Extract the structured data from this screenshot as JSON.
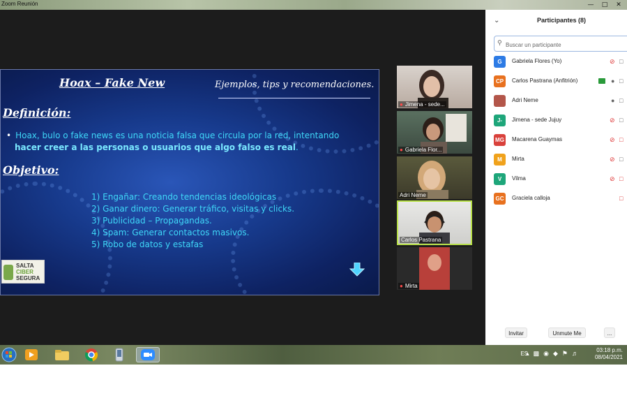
{
  "window": {
    "title": "Zoom Reunión"
  },
  "slide": {
    "title": "Hoax – Fake New",
    "subtitle": "Ejemplos, tips y recomendaciones.",
    "definition_heading": "Definición:",
    "definition_text": "Hoax, bulo o fake news es una noticia falsa que circula por la red, intentando",
    "definition_bold": "hacer creer a las personas o usuarios que algo falso es real",
    "definition_end": ".",
    "objective_heading": "Objetivo:",
    "objectives": [
      "1)  Engañar: Creando tendencias ideológicas",
      "2)  Ganar dinero: Generar tráfico, visitas y clicks.",
      "3)  Publicidad – Propagandas.",
      "4)  Spam: Generar contactos masivos.",
      "5)  Robo de datos y estafas"
    ],
    "logo": {
      "line1": "SALTA",
      "line2": "CIBER",
      "line3": "SEGURA"
    }
  },
  "gallery": [
    {
      "name": "Jimena - sede..."
    },
    {
      "name": "Gabriela Flor..."
    },
    {
      "name": "Adri Neme"
    },
    {
      "name": "Carlos Pastrana"
    },
    {
      "name": "Mirta"
    }
  ],
  "participants_panel": {
    "title": "Participantes (8)",
    "search_placeholder": "Buscar un participante",
    "participants": [
      {
        "initials": "G",
        "name": "Gabriela Flores (Yo)",
        "color": "#2d7be5"
      },
      {
        "initials": "CP",
        "name": "Carlos Pastrana (Anfitrión)",
        "color": "#e8711f"
      },
      {
        "initials": "",
        "name": "Adri Neme",
        "color": "#b3564a"
      },
      {
        "initials": "J-",
        "name": "Jimena - sede Jujuy",
        "color": "#1ea67a"
      },
      {
        "initials": "MG",
        "name": "Macarena Guaymas",
        "color": "#d9413b"
      },
      {
        "initials": "M",
        "name": "Mirta",
        "color": "#f0a21c"
      },
      {
        "initials": "V",
        "name": "Vilma",
        "color": "#1ea67a"
      },
      {
        "initials": "GC",
        "name": "Graciela calloja",
        "color": "#e8711f"
      }
    ],
    "invite_label": "Invitar",
    "unmute_label": "Unmute Me",
    "more_label": "..."
  },
  "taskbar": {
    "language": "ES",
    "time": "03:18 p.m.",
    "date": "08/04/2021"
  }
}
